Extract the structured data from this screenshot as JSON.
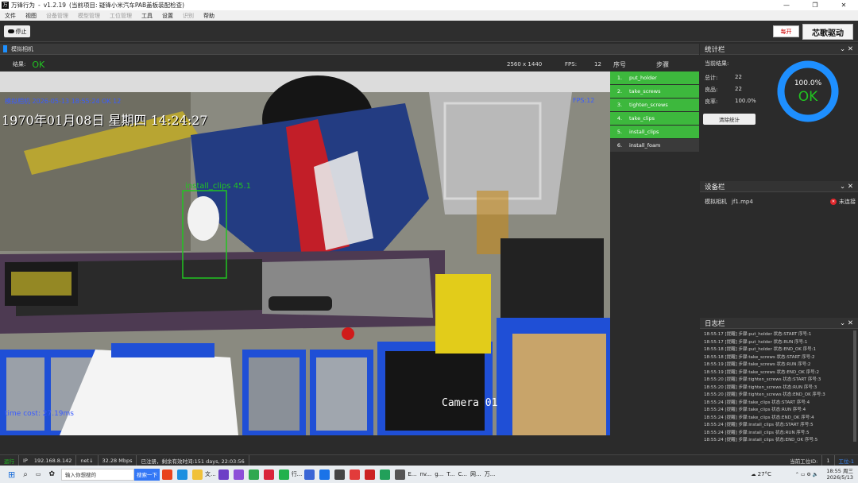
{
  "window": {
    "app_name": "万锋行为",
    "version": "v1.2.19",
    "project": "(当前项目: 疑锋小米汽车PAB盖板装配检查)",
    "controls": [
      "—",
      "❐",
      "✕"
    ]
  },
  "menu": {
    "items": [
      "文件",
      "视图",
      "设备管理",
      "模型管理",
      "工位管理",
      "工具",
      "设置",
      "识别",
      "帮助"
    ],
    "disabled": [
      2,
      3,
      4,
      7
    ]
  },
  "toolbar": {
    "stop_label": "停止",
    "logo1": "每开",
    "logo2": "芯歌驱动"
  },
  "camera_panel": {
    "title": "模拟相机"
  },
  "infobar": {
    "result_label": "结果:",
    "result_value": "OK",
    "resolution": "2560 x 1440",
    "fps_label": "FPS:",
    "fps_value": "12"
  },
  "overlay": {
    "top_left_info": "模拟相机 2026-05-13 18:55:24 OK 12",
    "datetime": "1970年01月08日  星期四  14:24:27",
    "fps_corner": "FPS:12",
    "detection_label": "install_clips 45.1",
    "time_cost": "time cost: 27.19ms",
    "camera_name": "Camera 01"
  },
  "steps": {
    "header_no": "序号",
    "header_step": "步骤",
    "rows": [
      {
        "n": "1.",
        "name": "put_holder",
        "done": true
      },
      {
        "n": "2.",
        "name": "take_screws",
        "done": true
      },
      {
        "n": "3.",
        "name": "tighten_screws",
        "done": true
      },
      {
        "n": "4.",
        "name": "take_clips",
        "done": true
      },
      {
        "n": "5.",
        "name": "install_clips",
        "done": true
      },
      {
        "n": "6.",
        "name": "install_foam",
        "done": false
      }
    ]
  },
  "stats": {
    "title": "统计栏",
    "current_result_label": "当前结果:",
    "total_label": "总计:",
    "total": "22",
    "good_label": "良品:",
    "good": "22",
    "yield_label": "良率:",
    "yield": "100.0%",
    "clear_button": "清除统计",
    "ring_percent": "100.0%",
    "ring_result": "OK",
    "ring_fraction": 1.0,
    "ring_color": "#1e8fff",
    "ok_color": "#21c521"
  },
  "device": {
    "title": "设备栏",
    "name": "模拟相机",
    "file": "jf1.mp4",
    "status": "未连接",
    "status_color": "#e0262b"
  },
  "log": {
    "title": "日志栏",
    "lines": [
      "18:55:17 [提醒] 步骤:put_holder 状态:START 序号:1",
      "18:55:17 [提醒] 步骤:put_holder 状态:RUN 序号:1",
      "18:55:18 [提醒] 步骤:put_holder 状态:END_OK 序号:1",
      "18:55:18 [提醒] 步骤:take_screws 状态:START 序号:2",
      "18:55:19 [提醒] 步骤:take_screws 状态:RUN 序号:2",
      "18:55:19 [提醒] 步骤:take_screws 状态:END_OK 序号:2",
      "18:55:20 [提醒] 步骤:tighten_screws 状态:START 序号:3",
      "18:55:20 [提醒] 步骤:tighten_screws 状态:RUN 序号:3",
      "18:55:20 [提醒] 步骤:tighten_screws 状态:END_OK 序号:3",
      "18:55:24 [提醒] 步骤:take_clips 状态:START 序号:4",
      "18:55:24 [提醒] 步骤:take_clips 状态:RUN 序号:4",
      "18:55:24 [提醒] 步骤:take_clips 状态:END_OK 序号:4",
      "18:55:24 [提醒] 步骤:install_clips 状态:START 序号:5",
      "18:55:24 [提醒] 步骤:install_clips 状态:RUN 序号:5",
      "18:55:24 [提醒] 步骤:install_clips 状态:END_OK 序号:5"
    ]
  },
  "statusbar": {
    "state": "运行",
    "ip_label": "IP",
    "ip": "192.168.8.142",
    "net_label": "net↓",
    "net": "32.28 Mbps",
    "reg": "已注册，剩余有效时间:151 days, 22:03:56",
    "station_label": "当前工位ID:",
    "station_id": "1",
    "station_name": "工位-1"
  },
  "taskbar": {
    "search_placeholder": "输入你想搜的",
    "search_button": "搜索一下",
    "apps": [
      "文...",
      "行...",
      "E...",
      "nv...",
      "g...",
      "T...",
      "C...",
      "网...",
      "万..."
    ],
    "weather": "27°C",
    "time": "18:55 周三",
    "date": "2026/5/13"
  }
}
